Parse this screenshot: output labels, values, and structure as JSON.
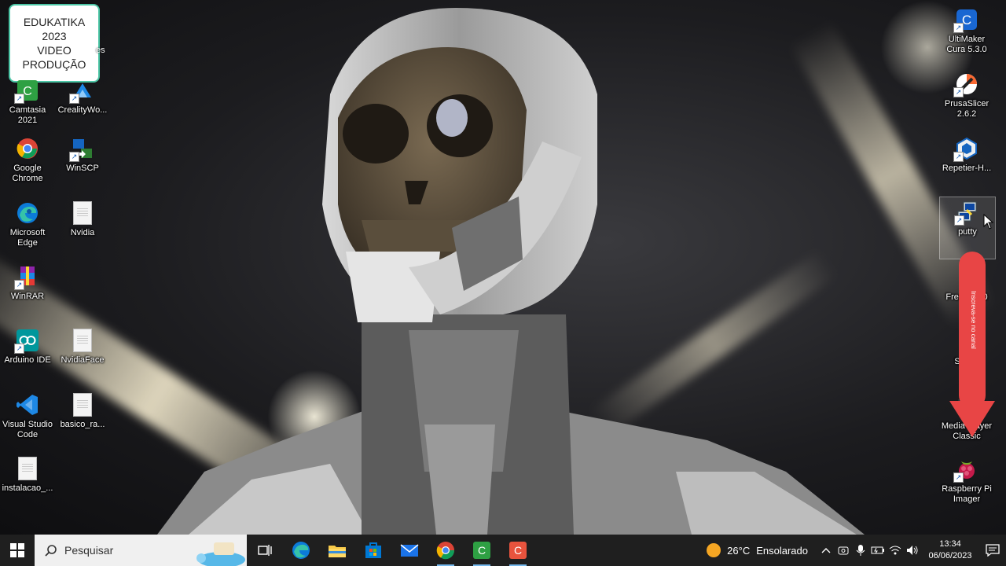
{
  "badge": {
    "line1": "EDUKATIKA",
    "line2": "2023",
    "line3": "VIDEO",
    "line4": "PRODUÇÃO"
  },
  "desktop_left": [
    {
      "label": "Camtasia 2021",
      "icon": "camtasia-icon"
    },
    {
      "label": "CrealityWo...",
      "icon": "creality-icon"
    },
    {
      "label": "Google Chrome",
      "icon": "chrome-icon"
    },
    {
      "label": "WinSCP",
      "icon": "winscp-icon"
    },
    {
      "label": "Microsoft Edge",
      "icon": "edge-icon"
    },
    {
      "label": "Nvidia",
      "icon": "file-icon"
    },
    {
      "label": "WinRAR",
      "icon": "winrar-icon"
    },
    {
      "label": "Arduino IDE",
      "icon": "arduino-icon"
    },
    {
      "label": "NvidiaFace",
      "icon": "file-icon"
    },
    {
      "label": "Visual Studio Code",
      "icon": "vscode-icon"
    },
    {
      "label": "basico_ra...",
      "icon": "file-icon"
    },
    {
      "label": "instalacao_...",
      "icon": "file-icon"
    }
  ],
  "partial_label": "es",
  "desktop_right": [
    {
      "label": "UltiMaker Cura 5.3.0",
      "icon": "cura-icon"
    },
    {
      "label": "PrusaSlicer 2.6.2",
      "icon": "prusaslicer-icon"
    },
    {
      "label": "Repetier-H...",
      "icon": "repetier-icon"
    },
    {
      "label": "putty",
      "icon": "putty-icon"
    },
    {
      "label": "Free",
      "icon": "free-icon",
      "suffix": "20"
    },
    {
      "label": "SD Fo",
      "icon": "sd-icon"
    },
    {
      "label": "Media Player Classic",
      "icon": "media-player-icon"
    },
    {
      "label": "Raspberry Pi Imager",
      "icon": "raspberry-pi-icon"
    }
  ],
  "arrow_text": "Inscreva-se no canal",
  "taskbar": {
    "search_placeholder": "Pesquisar",
    "apps": [
      "task-view",
      "edge",
      "file-explorer",
      "microsoft-store",
      "mail",
      "chrome",
      "camtasia-green",
      "camtasia-red"
    ],
    "weather_temp": "26°C",
    "weather_desc": "Ensolarado",
    "time": "13:34",
    "date": "06/06/2023"
  },
  "colors": {
    "taskbar": "#1f1f1f",
    "arrow": "#e84545",
    "badge_border": "#4cc6a6"
  }
}
